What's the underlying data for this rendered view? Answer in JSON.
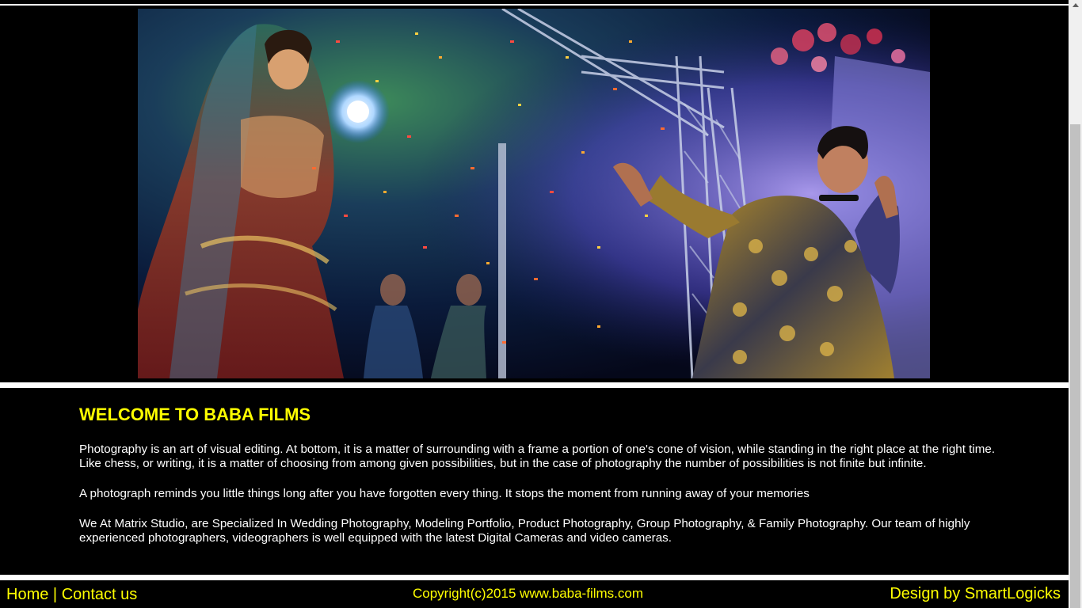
{
  "hero": {
    "image_name": "wedding-dance-stage-photo"
  },
  "welcome": {
    "title": "WELCOME TO BABA FILMS",
    "paragraphs": [
      "Photography is an art of visual editing. At bottom, it is a matter of surrounding with a frame a portion of one's cone of vision, while standing in the right place at the right time. Like chess, or writing, it is a matter of choosing from among given possibilities, but in the case of photography the number of possibilities is not finite but infinite.",
      "A photograph reminds you little things long after you have forgotten every thing. It stops the moment from running away of your memories",
      "We At Matrix Studio, are Specialized In Wedding Photography, Modeling Portfolio, Product Photography, Group Photography, & Family Photography. Our team of highly experienced photographers, videographers is well equipped with the latest Digital Cameras and video cameras."
    ]
  },
  "footer": {
    "home_label": "Home",
    "separator": "|",
    "contact_label": "Contact us",
    "copyright": "Copyright(c)2015 www.baba-films.com",
    "credit": "Design by SmartLogicks"
  },
  "colors": {
    "background": "#000000",
    "accent": "#ffff00",
    "text": "#ffffff"
  }
}
